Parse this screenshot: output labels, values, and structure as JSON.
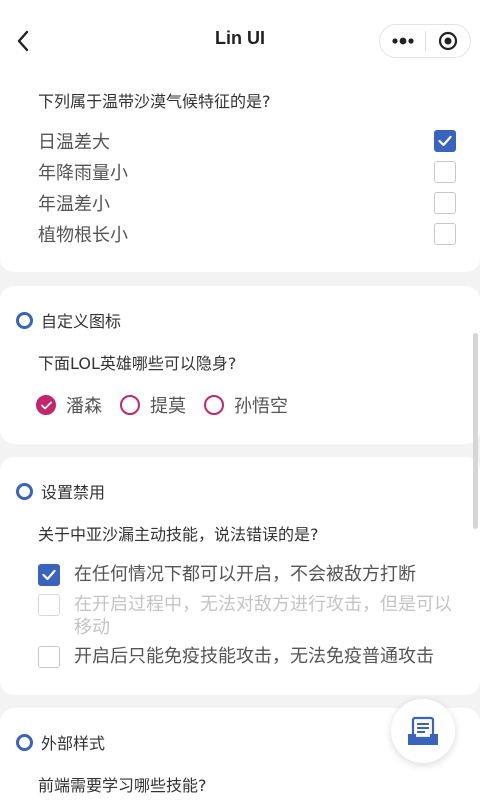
{
  "navbar": {
    "title": "Lin UI",
    "back_icon": "chevron-left-icon",
    "more_icon": "more-dots-icon",
    "target_icon": "target-icon"
  },
  "card1": {
    "question": "下列属于温带沙漠气候特征的是?",
    "options": [
      {
        "label": "日温差大",
        "checked": true
      },
      {
        "label": "年降雨量小",
        "checked": false
      },
      {
        "label": "年温差小",
        "checked": false
      },
      {
        "label": "植物根长小",
        "checked": false
      }
    ]
  },
  "card2": {
    "title": "自定义图标",
    "question": "下面LOL英雄哪些可以隐身?",
    "options": [
      {
        "label": "潘森",
        "checked": true
      },
      {
        "label": "提莫",
        "checked": false
      },
      {
        "label": "孙悟空",
        "checked": false
      }
    ]
  },
  "card3": {
    "title": "设置禁用",
    "question": "关于中亚沙漏主动技能，说法错误的是?",
    "options": [
      {
        "label": "在任何情况下都可以开启，不会被敌方打断",
        "checked": true,
        "disabled": false
      },
      {
        "label": "在开启过程中，无法对敌方进行攻击，但是可以移动",
        "checked": false,
        "disabled": true
      },
      {
        "label": "开启后只能免疫技能攻击，无法免疫普通攻击",
        "checked": false,
        "disabled": false
      }
    ]
  },
  "card4": {
    "title": "外部样式",
    "question": "前端需要学习哪些技能?"
  },
  "colors": {
    "primary": "#3963bc",
    "radio_accent": "#c3266a",
    "disabled_text": "#c4c4c4"
  },
  "fab": {
    "icon": "document-icon"
  }
}
